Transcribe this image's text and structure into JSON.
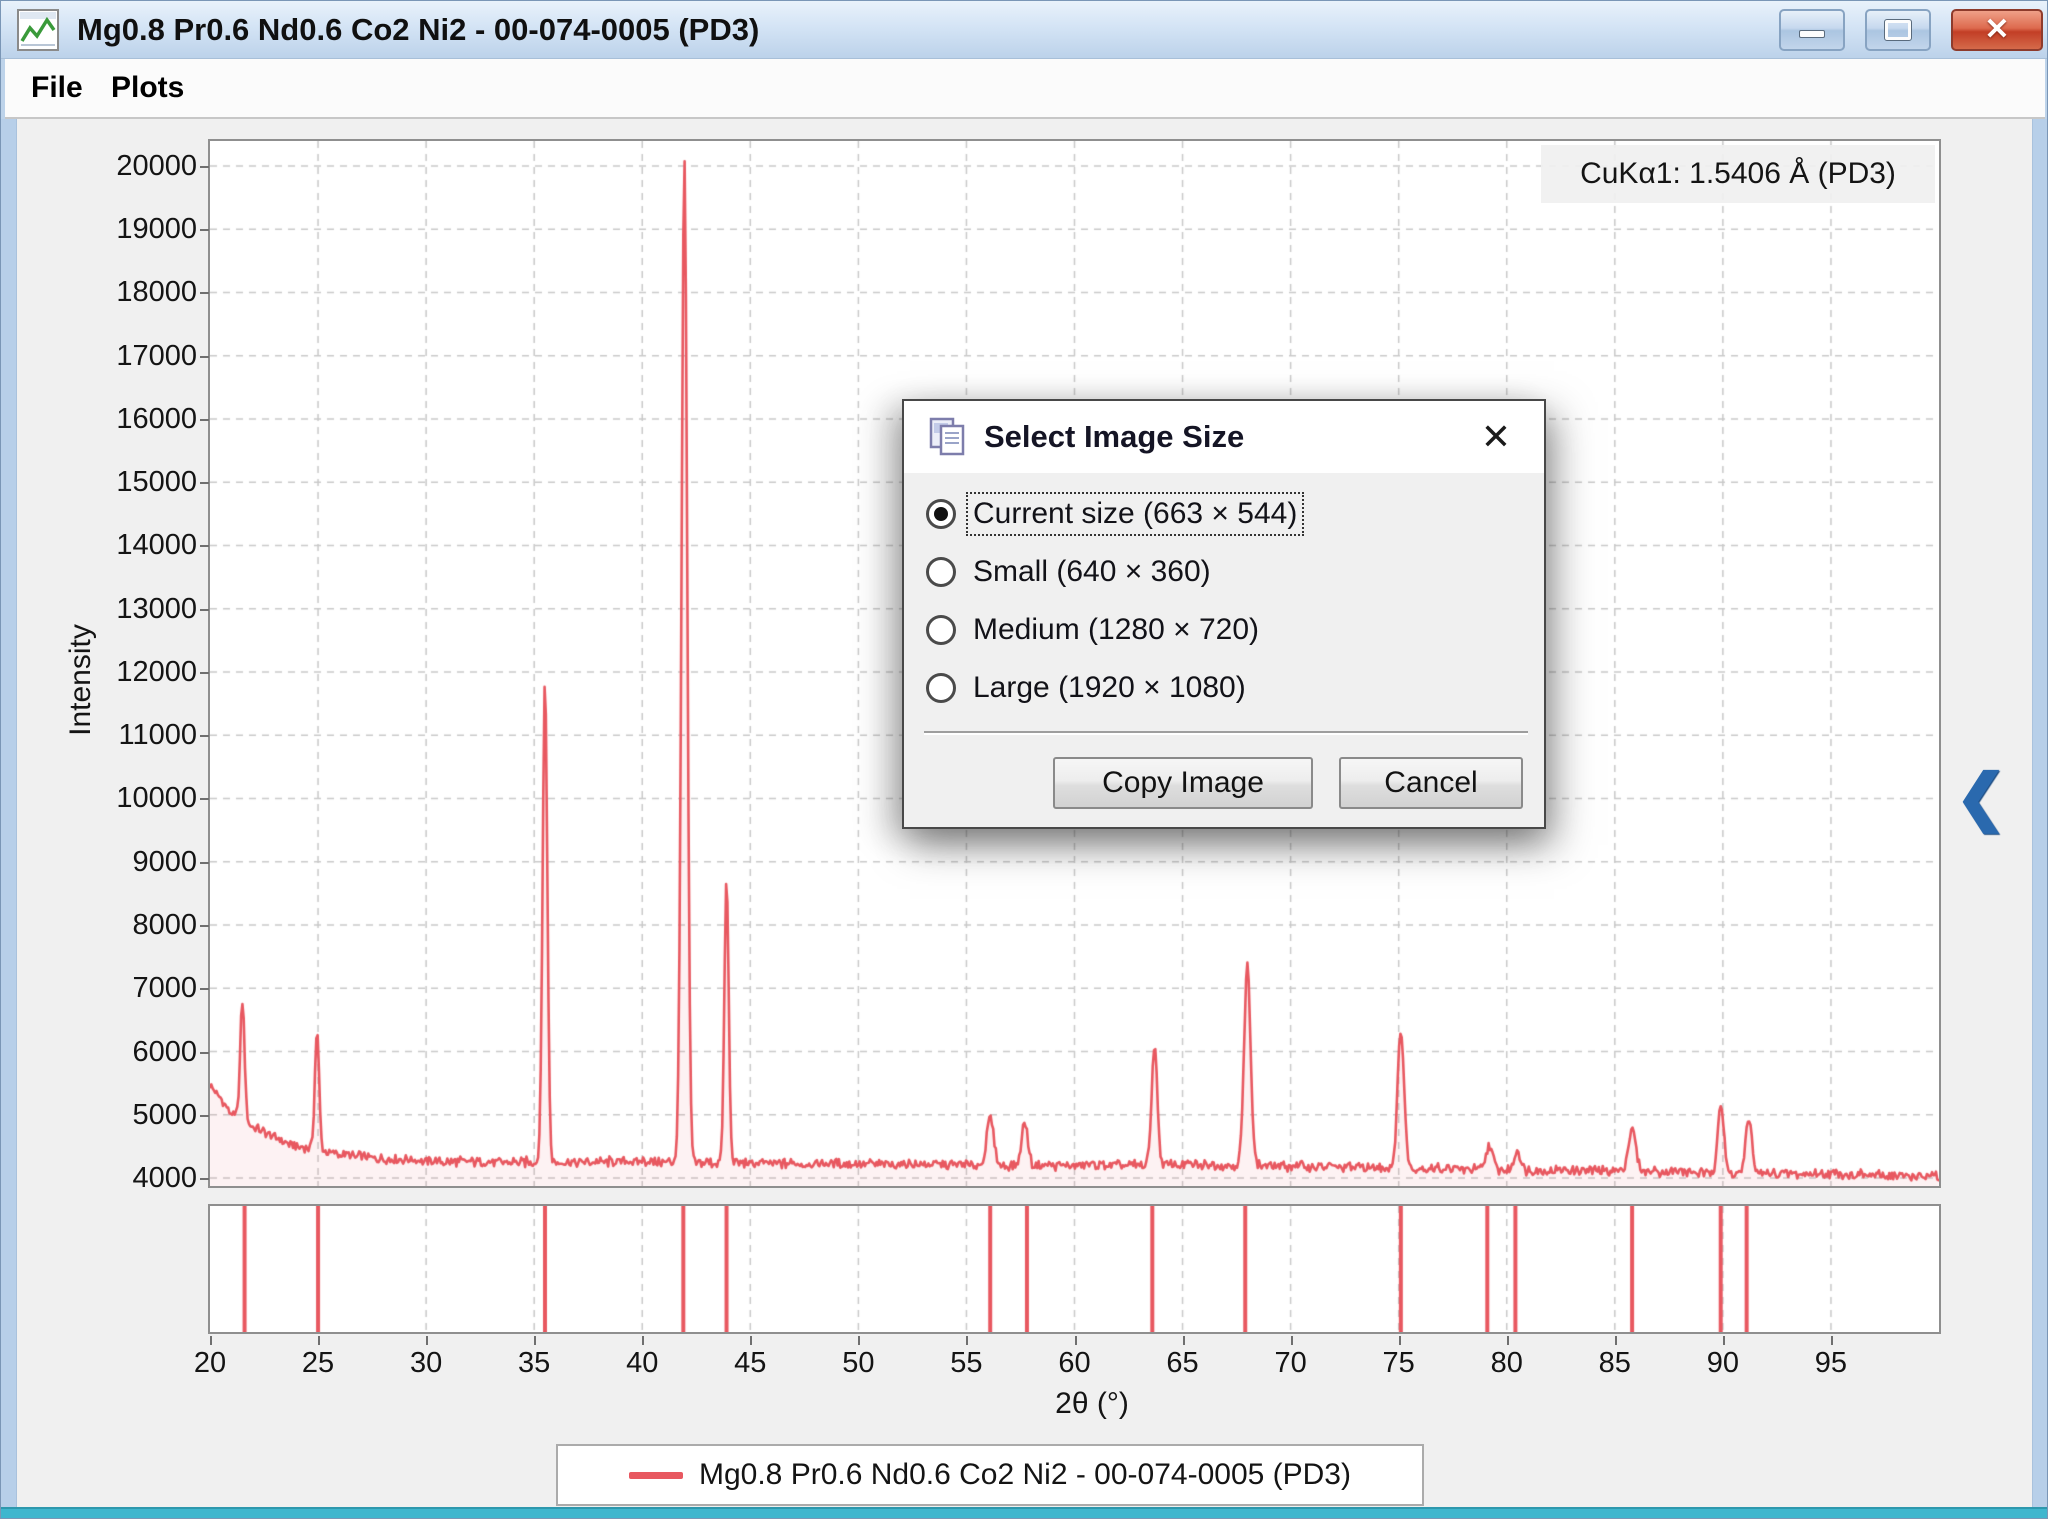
{
  "window": {
    "title": "Mg0.8 Pr0.6 Nd0.6 Co2 Ni2 - 00-074-0005 (PD3)"
  },
  "menu": {
    "items": [
      {
        "label": "File"
      },
      {
        "label": "Plots"
      }
    ]
  },
  "chart_data": {
    "type": "line",
    "xlabel": "2θ (°)",
    "ylabel": "Intensity",
    "xlim": [
      20,
      100
    ],
    "ylim": [
      3874,
      20394
    ],
    "xticks": [
      20,
      25,
      30,
      35,
      40,
      45,
      50,
      55,
      60,
      65,
      70,
      75,
      80,
      85,
      90,
      95
    ],
    "yticks": [
      4000,
      5000,
      6000,
      7000,
      8000,
      9000,
      10000,
      11000,
      12000,
      13000,
      14000,
      15000,
      16000,
      17000,
      18000,
      19000,
      20000
    ],
    "grid": "dashed",
    "annotation": "CuKα1: 1.5406 Å (PD3)",
    "series": [
      {
        "name": "Mg0.8 Pr0.6 Nd0.6 Co2 Ni2 - 00-074-0005 (PD3)",
        "color": "#e85860",
        "noise_amplitude": 65,
        "background_anchors": [
          [
            20,
            5480
          ],
          [
            20.7,
            5150
          ],
          [
            21,
            5020
          ],
          [
            22,
            4800
          ],
          [
            23,
            4640
          ],
          [
            24,
            4500
          ],
          [
            25,
            4430
          ],
          [
            26.5,
            4350
          ],
          [
            28,
            4300
          ],
          [
            31,
            4260
          ],
          [
            35,
            4250
          ],
          [
            40,
            4260
          ],
          [
            45,
            4230
          ],
          [
            50,
            4220
          ],
          [
            55,
            4210
          ],
          [
            60,
            4200
          ],
          [
            65,
            4210
          ],
          [
            70,
            4190
          ],
          [
            75,
            4160
          ],
          [
            78,
            4140
          ],
          [
            82,
            4120
          ],
          [
            86,
            4110
          ],
          [
            90,
            4080
          ],
          [
            95,
            4060
          ],
          [
            100,
            4020
          ]
        ],
        "peaks": [
          {
            "two_theta": 21.5,
            "intensity": 6800,
            "width": 0.1
          },
          {
            "two_theta": 24.95,
            "intensity": 6300,
            "width": 0.1
          },
          {
            "two_theta": 35.5,
            "intensity": 11800,
            "width": 0.11
          },
          {
            "two_theta": 41.95,
            "intensity": 20080,
            "width": 0.13
          },
          {
            "two_theta": 43.9,
            "intensity": 8700,
            "width": 0.1
          },
          {
            "two_theta": 56.1,
            "intensity": 4950,
            "width": 0.16
          },
          {
            "two_theta": 57.7,
            "intensity": 4900,
            "width": 0.14
          },
          {
            "two_theta": 63.7,
            "intensity": 6100,
            "width": 0.13
          },
          {
            "two_theta": 68.0,
            "intensity": 7350,
            "width": 0.15
          },
          {
            "two_theta": 75.1,
            "intensity": 6350,
            "width": 0.15
          },
          {
            "two_theta": 79.2,
            "intensity": 4520,
            "width": 0.15
          },
          {
            "two_theta": 80.5,
            "intensity": 4450,
            "width": 0.13
          },
          {
            "two_theta": 85.8,
            "intensity": 4780,
            "width": 0.17
          },
          {
            "two_theta": 89.9,
            "intensity": 5180,
            "width": 0.14
          },
          {
            "two_theta": 91.2,
            "intensity": 4950,
            "width": 0.14
          }
        ]
      }
    ],
    "reference_ticks": {
      "color": "#e85860",
      "positions": [
        21.6,
        25.0,
        35.5,
        41.9,
        43.9,
        56.1,
        57.8,
        63.6,
        67.9,
        75.1,
        79.1,
        80.4,
        85.8,
        89.9,
        91.1
      ]
    }
  },
  "legend": {
    "label": "Mg0.8 Pr0.6 Nd0.6 Co2 Ni2 - 00-074-0005 (PD3)"
  },
  "dialog": {
    "title": "Select Image Size",
    "options": [
      {
        "label": "Current size (663 × 544)",
        "selected": true
      },
      {
        "label": "Small (640 × 360)",
        "selected": false
      },
      {
        "label": "Medium (1280 × 720)",
        "selected": false
      },
      {
        "label": "Large (1920 × 1080)",
        "selected": false
      }
    ],
    "buttons": [
      {
        "label": "Copy Image"
      },
      {
        "label": "Cancel"
      }
    ]
  }
}
